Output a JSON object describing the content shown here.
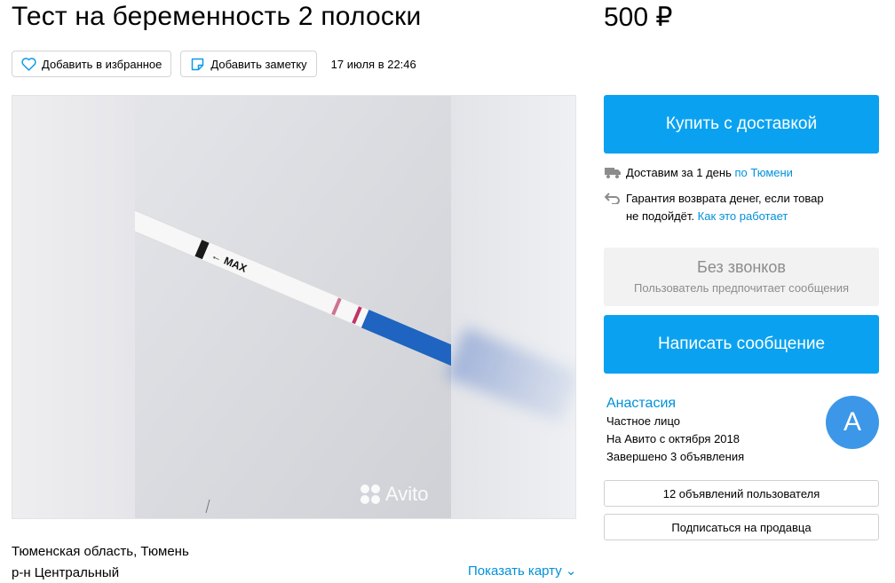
{
  "listing": {
    "title": "Тест на беременность 2 полоски",
    "price": "500 ₽",
    "favorite_label": "Добавить в избранное",
    "note_label": "Добавить заметку",
    "date": "17 июля в 22:46",
    "watermark": "Avito"
  },
  "location": {
    "region": "Тюменская область, Тюмень",
    "district": "р-н Центральный",
    "map_link": "Показать карту ⌄"
  },
  "purchase": {
    "buy_label": "Купить с доставкой",
    "delivery_text": "Доставим за 1 день ",
    "delivery_link": "по Тюмени",
    "guarantee_text_1": "Гарантия возврата денег, если товар",
    "guarantee_text_2": "не подойдёт. ",
    "guarantee_link": "Как это работает"
  },
  "contact": {
    "no_calls_title": "Без звонков",
    "no_calls_sub": "Пользователь предпочитает сообщения",
    "message_label": "Написать сообщение"
  },
  "seller": {
    "name": "Анастасия",
    "type": "Частное лицо",
    "since": "На Авито с октября 2018",
    "completed": "Завершено 3 объявления",
    "avatar_letter": "А",
    "ads_button": "12 объявлений пользователя",
    "subscribe_button": "Подписаться на продавца"
  },
  "colors": {
    "accent": "#0aa2f0",
    "link": "#0091d9",
    "avatar": "#3c97e8"
  }
}
